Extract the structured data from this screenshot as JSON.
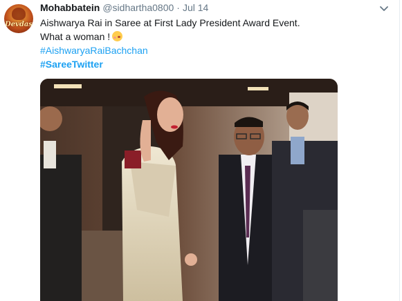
{
  "tweet": {
    "avatar_label": "Devdas",
    "display_name": "Mohabbatein",
    "handle": "@sidhartha0800",
    "separator": "·",
    "date": "Jul 14",
    "lines": [
      "Aishwarya Rai in Saree at First Lady President Award Event.",
      "What a woman !"
    ],
    "emoji": "kissing-face-emoji",
    "hashtags": [
      "#AishwaryaRaiBachchan",
      "#SareeTwitter"
    ],
    "menu_icon": "chevron-down-icon",
    "photo": "event-photo"
  },
  "colors": {
    "link": "#1da1f2",
    "secondary_text": "#657786",
    "primary_text": "#14171a"
  }
}
